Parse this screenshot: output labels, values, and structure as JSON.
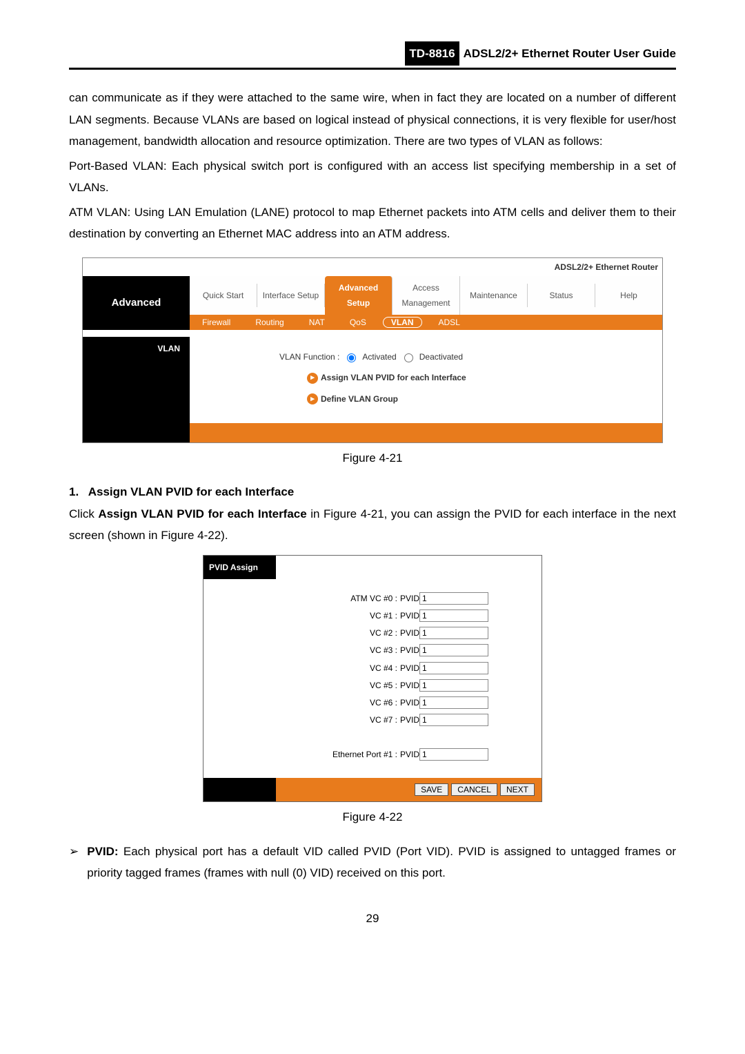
{
  "header": {
    "model": "TD-8816",
    "title": "ADSL2/2+ Ethernet Router User Guide"
  },
  "body": {
    "para1": "can communicate as if they were attached to the same wire, when in fact they are located on a number of different LAN segments. Because VLANs are based on logical instead of physical connections, it is very flexible for user/host management, bandwidth allocation and resource optimization. There are two types of VLAN as follows:",
    "para2": "Port-Based VLAN: Each physical switch port is configured with an access list specifying membership in a set of VLANs.",
    "para3": "ATM VLAN: Using LAN Emulation (LANE) protocol to map Ethernet packets into ATM cells and deliver them to their destination by converting an Ethernet MAC address into an ATM address."
  },
  "router": {
    "brand": "ADSL2/2+ Ethernet Router",
    "side_title": "Advanced",
    "tabs_primary": [
      "Quick Start",
      "Interface Setup",
      "Advanced Setup",
      "Access Management",
      "Maintenance",
      "Status",
      "Help"
    ],
    "tabs_secondary": [
      "Firewall",
      "Routing",
      "NAT",
      "QoS",
      "VLAN",
      "ADSL"
    ],
    "section_label": "VLAN",
    "vlan_fn_label": "VLAN Function :",
    "opt_activated": "Activated",
    "opt_deactivated": "Deactivated",
    "link1": "Assign VLAN PVID for each Interface",
    "link2": "Define VLAN Group"
  },
  "fig1_caption": "Figure 4-21",
  "list_item1_num": "1.",
  "list_item1_title": "Assign VLAN PVID for each Interface",
  "para_after_list_a": "Click ",
  "para_after_list_b": "Assign VLAN PVID for each Interface",
  "para_after_list_c": " in Figure 4-21, you can assign the PVID for each interface in the next screen (shown in Figure 4-22).",
  "pvid": {
    "head": "PVID Assign",
    "rows": [
      {
        "label": "ATM VC #0 :",
        "ph": "PVID",
        "val": "1"
      },
      {
        "label": "VC #1 :",
        "ph": "PVID",
        "val": "1"
      },
      {
        "label": "VC #2 :",
        "ph": "PVID",
        "val": "1"
      },
      {
        "label": "VC #3 :",
        "ph": "PVID",
        "val": "1"
      },
      {
        "label": "VC #4 :",
        "ph": "PVID",
        "val": "1"
      },
      {
        "label": "VC #5 :",
        "ph": "PVID",
        "val": "1"
      },
      {
        "label": "VC #6 :",
        "ph": "PVID",
        "val": "1"
      },
      {
        "label": "VC #7 :",
        "ph": "PVID",
        "val": "1"
      }
    ],
    "eth_label": "Ethernet Port #1 :",
    "eth_ph": "PVID",
    "eth_val": "1",
    "btn_save": "SAVE",
    "btn_cancel": "CANCEL",
    "btn_next": "NEXT"
  },
  "fig2_caption": "Figure 4-22",
  "pvid_desc_prefix": "PVID:",
  "pvid_desc": " Each physical port has a default VID called PVID (Port VID). PVID is assigned to untagged frames or priority tagged frames (frames with null (0) VID) received on this port.",
  "page_number": "29"
}
